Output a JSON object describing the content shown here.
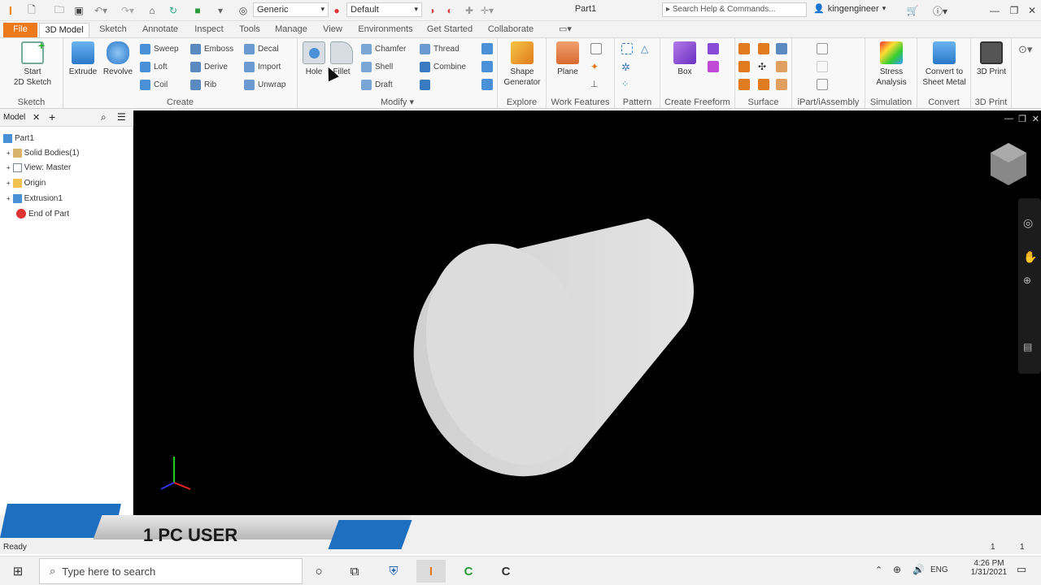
{
  "titlebar": {
    "app_letter": "I",
    "material": "Generic",
    "appearance": "Default",
    "document": "Part1",
    "search_placeholder": "Search Help & Commands...",
    "user": "kingengineer"
  },
  "tabs": [
    "File",
    "3D Model",
    "Sketch",
    "Annotate",
    "Inspect",
    "Tools",
    "Manage",
    "View",
    "Environments",
    "Get Started",
    "Collaborate"
  ],
  "ribbon": {
    "sketch": {
      "start_line1": "Start",
      "start_line2": "2D Sketch",
      "panel": "Sketch"
    },
    "create": {
      "extrude": "Extrude",
      "revolve": "Revolve",
      "sweep": "Sweep",
      "loft": "Loft",
      "coil": "Coil",
      "emboss": "Emboss",
      "derive": "Derive",
      "rib": "Rib",
      "decal": "Decal",
      "import": "Import",
      "unwrap": "Unwrap",
      "panel": "Create"
    },
    "modify": {
      "hole": "Hole",
      "fillet": "Fillet",
      "chamfer": "Chamfer",
      "shell": "Shell",
      "draft": "Draft",
      "thread": "Thread",
      "combine": "Combine",
      "panel": "Modify ▾"
    },
    "explore": {
      "line1": "Shape",
      "line2": "Generator",
      "panel": "Explore"
    },
    "work": {
      "plane": "Plane",
      "panel": "Work Features"
    },
    "pattern": {
      "panel": "Pattern"
    },
    "freeform": {
      "box": "Box",
      "panel": "Create Freeform"
    },
    "surface": {
      "panel": "Surface"
    },
    "ipart": {
      "panel": "iPart/iAssembly"
    },
    "simulation": {
      "line1": "Stress",
      "line2": "Analysis",
      "panel": "Simulation"
    },
    "convert": {
      "line1": "Convert to",
      "line2": "Sheet Metal",
      "panel": "Convert"
    },
    "print": {
      "btn": "3D Print",
      "panel": "3D Print"
    }
  },
  "browser": {
    "tab": "Model",
    "items": [
      "Part1",
      "Solid Bodies(1)",
      "View: Master",
      "Origin",
      "Extrusion1",
      "End of Part"
    ]
  },
  "banner": {
    "text": "1 PC USER"
  },
  "status": {
    "text": "Ready",
    "n1": "1",
    "n2": "1"
  },
  "taskbar": {
    "search_placeholder": "Type here to search",
    "lang": "ENG",
    "time": "4:26 PM",
    "date": "1/31/2021"
  },
  "colors": {
    "accent": "#ec7a1c",
    "viewport": "#000000",
    "banner": "#1e6fc0",
    "shape": "#e0e0e0"
  }
}
